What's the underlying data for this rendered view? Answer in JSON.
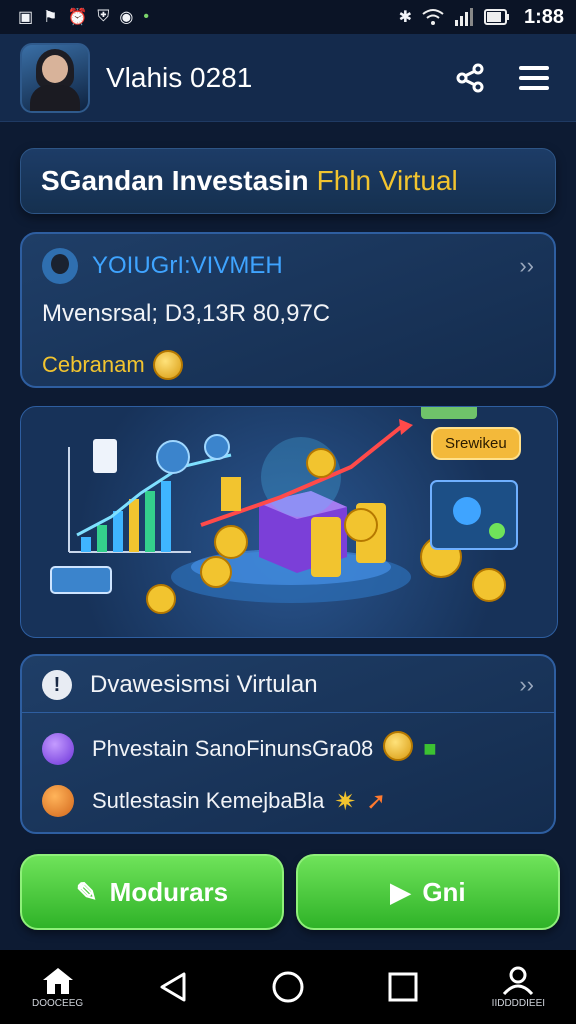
{
  "status_bar": {
    "time": "1:88",
    "left_icons": [
      "app-icon",
      "flag-icon",
      "alarm-icon",
      "shield-icon",
      "circle-icon",
      "notification-dot-icon"
    ],
    "right_icons": [
      "bluetooth-icon",
      "wifi-icon",
      "signal-icon",
      "battery-icon"
    ]
  },
  "app_bar": {
    "title": "Vlahis 0281",
    "actions": [
      "share-icon",
      "menu-icon"
    ]
  },
  "banner": {
    "title": "SGandan Investasin",
    "highlight": "Fhln Virtual"
  },
  "account_card": {
    "name": "YOIUGrI:VIVMEH",
    "balance": "Mvensrsal; D3,13R 80,97C",
    "sub_label": "Cebranam"
  },
  "illustration": {
    "tag": "Srewikeu"
  },
  "virtual_card": {
    "title": "Dvawesismsi Virtulan",
    "items": [
      {
        "label": "Phvestain SanoFinunsGra08"
      },
      {
        "label": "Sutlestasin KemejbaBla"
      }
    ]
  },
  "buttons": {
    "left_label": "Modurars",
    "right_label": "Gni"
  },
  "nav_bar": {
    "home_label": "DOOCEEG",
    "profile_label": "IIDDDDIEEI"
  },
  "colors": {
    "accent_green": "#3cc232",
    "accent_yellow": "#f2c42f",
    "accent_blue": "#3fa4ff",
    "background": "#0d1b33"
  }
}
